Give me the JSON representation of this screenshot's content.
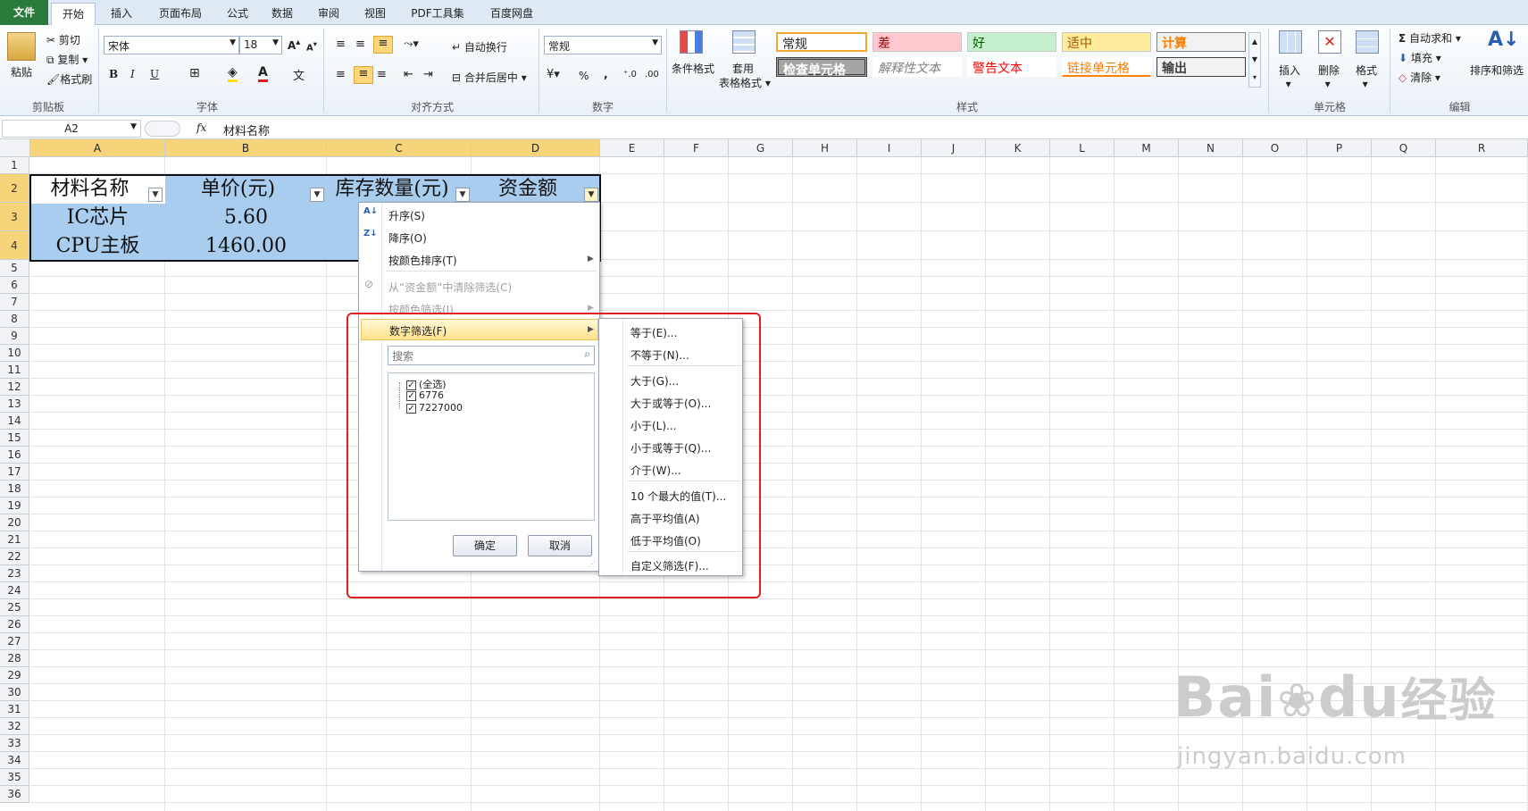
{
  "tabs": [
    "文件",
    "开始",
    "插入",
    "页面布局",
    "公式",
    "数据",
    "审阅",
    "视图",
    "PDF工具集",
    "百度网盘"
  ],
  "ribbon": {
    "clipboard": {
      "paste": "粘贴",
      "cut": "剪切",
      "copy": "复制",
      "format_painter": "格式刷",
      "label": "剪贴板"
    },
    "font": {
      "name": "宋体",
      "size": "18",
      "bold": "B",
      "italic": "I",
      "underline": "U",
      "label": "字体"
    },
    "align": {
      "wrap": "自动换行",
      "merge": "合并后居中",
      "label": "对齐方式"
    },
    "number": {
      "format": "常规",
      "percent": "%",
      "comma": ",",
      "label": "数字"
    },
    "styles": {
      "cond_format": "条件格式",
      "table_format_1": "套用",
      "table_format_2": "表格格式",
      "cells": [
        {
          "text": "常规"
        },
        {
          "text": "差"
        },
        {
          "text": "好"
        },
        {
          "text": "适中"
        },
        {
          "text": "计算"
        },
        {
          "text": "检查单元格"
        },
        {
          "text": "解释性文本"
        },
        {
          "text": "警告文本"
        },
        {
          "text": "链接单元格"
        },
        {
          "text": "输出"
        }
      ],
      "label": "样式"
    },
    "cells_group": {
      "insert": "插入",
      "delete": "删除",
      "format": "格式",
      "label": "单元格"
    },
    "editing": {
      "autosum": "自动求和",
      "fill": "填充",
      "clear": "清除",
      "sort_filter": "排序和筛选",
      "label": "编辑"
    }
  },
  "formula_bar": {
    "name_box": "A2",
    "fx": "fx",
    "content": "材料名称"
  },
  "columns": [
    "A",
    "B",
    "C",
    "D",
    "E",
    "F",
    "G",
    "H",
    "I",
    "J",
    "K",
    "L",
    "M",
    "N",
    "O",
    "P",
    "Q",
    "R"
  ],
  "rows": [
    "1",
    "2",
    "3",
    "4",
    "5",
    "6",
    "7",
    "8",
    "9",
    "10",
    "11",
    "12",
    "13",
    "14",
    "15",
    "16",
    "17",
    "18",
    "19",
    "20",
    "21",
    "22",
    "23",
    "24",
    "25",
    "26",
    "27",
    "28",
    "29",
    "30",
    "31",
    "32",
    "33",
    "34",
    "35",
    "36"
  ],
  "table": {
    "headers": [
      "材料名称",
      "单价(元)",
      "库存数量(元)",
      "资金额"
    ],
    "rows": [
      [
        "IC芯片",
        "5.60"
      ],
      [
        "CPU主板",
        "1460.00"
      ]
    ]
  },
  "filter_menu": {
    "sort_asc": "升序(S)",
    "sort_desc": "降序(O)",
    "sort_color": "按颜色排序(T)",
    "clear_filter": "从“资金额”中清除筛选(C)",
    "filter_color": "按颜色筛选(I)",
    "number_filter": "数字筛选(F)",
    "search_placeholder": "搜索",
    "items": [
      "(全选)",
      "6776",
      "7227000"
    ],
    "ok": "确定",
    "cancel": "取消"
  },
  "submenu": [
    "等于(E)...",
    "不等于(N)...",
    "大于(G)...",
    "大于或等于(O)...",
    "小于(L)...",
    "小于或等于(Q)...",
    "介于(W)...",
    "10 个最大的值(T)...",
    "高于平均值(A)",
    "低于平均值(O)",
    "自定义筛选(F)..."
  ],
  "watermark": {
    "brand": "Bai",
    "brand2": "du",
    "cn": "经验",
    "url": "jingyan.baidu.com"
  },
  "colors": {
    "highlight": "#e02020",
    "selected_header": "#f6d47a",
    "table_fill": "#a9cdee"
  }
}
